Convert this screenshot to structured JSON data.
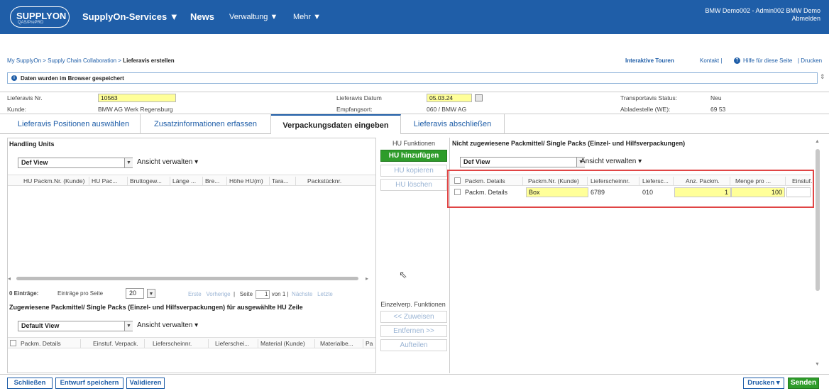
{
  "brand": {
    "logo_main": "SUPPLYON",
    "logo_sub": "QAS/PrePRD"
  },
  "nav": {
    "services": "SupplyOn-Services ▼",
    "news": "News",
    "admin": "Verwaltung ▼",
    "more": "Mehr ▼"
  },
  "user": {
    "name": "BMW Demo002 - Admin002 BMW Demo",
    "logout": "Abmelden"
  },
  "breadcrumb": {
    "path": "My SupplyOn > Supply Chain Collaboration > ",
    "current": "Lieferavis erstellen"
  },
  "toplinks": {
    "tours": "Interaktive Touren",
    "contact": "Kontakt |",
    "help": "Hilfe für diese Seite",
    "print": "| Drucken"
  },
  "info": {
    "message": "Daten wurden im Browser gespeichert"
  },
  "header": {
    "avis_nr_label": "Lieferavis Nr.",
    "avis_nr": "10563",
    "kunde_label": "Kunde:",
    "kunde": "BMW AG Werk Regensburg",
    "datum_label": "Lieferavis Datum",
    "datum": "05.03.24",
    "empf_label": "Empfangsort:",
    "empf": "060 / BMW AG",
    "status_label": "Transportavis Status:",
    "status": "Neu",
    "ablade_label": "Abladestelle (WE):",
    "ablade": "69 53"
  },
  "tabs": [
    "Lieferavis Positionen auswählen",
    "Zusatzinformationen erfassen",
    "Verpackungsdaten eingeben",
    "Lieferavis abschließen"
  ],
  "left": {
    "title": "Handling Units",
    "view": "Def View",
    "manage": "Ansicht verwalten",
    "columns": [
      "HU Packm.Nr. (Kunde)",
      "HU Pac...",
      "Bruttogew...",
      "Länge ...",
      "Bre...",
      "Höhe HU(m)",
      "Tara...",
      "Packstücknr."
    ],
    "pager": {
      "count": "0 Einträge:",
      "per_page_label": "Einträge pro Seite",
      "per_page": "20",
      "first": "Erste",
      "prev": "Vorherige",
      "page_label": "Seite",
      "page": "1",
      "of": "von 1",
      "next": "Nächste",
      "last": "Letzte"
    },
    "assigned_title": "Zugewiesene Packmittel/ Single Packs (Einzel- und Hilfsverpackungen) für ausgewählte HU Zeile",
    "assigned_view": "Default View",
    "assigned_columns": [
      "Packm. Details",
      "Einstuf. Verpack.",
      "Lieferscheinnr.",
      "Lieferschei...",
      "Material (Kunde)",
      "Materialbe...",
      "Pa"
    ]
  },
  "mid": {
    "hu_title": "HU Funktionen",
    "add": "HU hinzufügen",
    "copy": "HU kopieren",
    "delete": "HU löschen",
    "single_title": "Einzelverp. Funktionen",
    "assign": "<< Zuweisen",
    "remove": "Entfernen >>",
    "split": "Aufteilen"
  },
  "right": {
    "title": "Nicht zugewiesene Packmittel/ Single Packs (Einzel- und Hilfsverpackungen)",
    "view": "Def View",
    "manage": "Ansicht verwalten",
    "columns": [
      "Packm. Details",
      "Packm.Nr. (Kunde)",
      "Lieferscheinnr.",
      "Liefersc...",
      "Anz. Packm.",
      "Menge pro ...",
      "Einstuf."
    ],
    "row": {
      "details": "Packm. Details",
      "packm_nr": "Box",
      "lieferschein": "6789",
      "liefersc": "010",
      "anz": "1",
      "menge": "100"
    }
  },
  "footer": {
    "close": "Schließen",
    "save": "Entwurf speichern",
    "validate": "Validieren",
    "print": "Drucken",
    "send": "Senden"
  },
  "colors": {
    "brand": "#1f5ea8",
    "green": "#2e9c2a",
    "highlight": "#e04545",
    "input_yellow": "#ffff99"
  }
}
